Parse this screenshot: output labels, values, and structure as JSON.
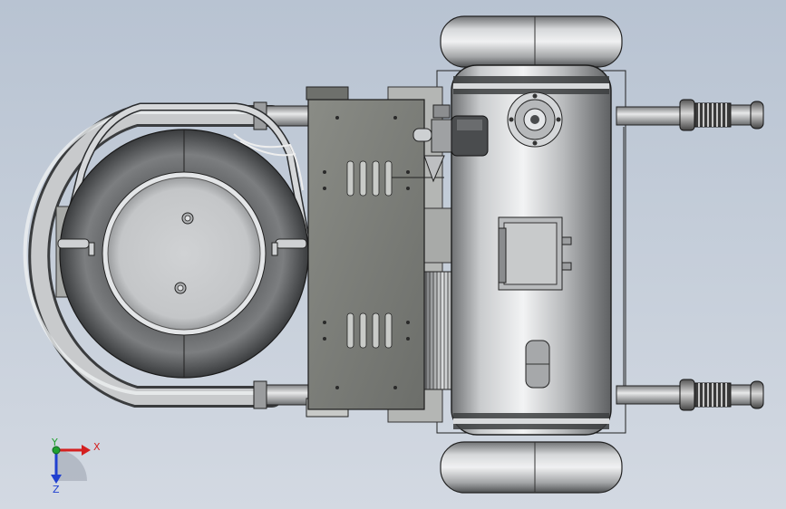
{
  "view": {
    "background_top": "#b8c3d2",
    "background_bottom": "#d3d9e2",
    "model_subject": "compressor-assembly-top-view"
  },
  "triad": {
    "x_label": "X",
    "y_label": "Y",
    "z_label": "Z",
    "x_color": "#d42020",
    "y_color": "#20a030",
    "z_color": "#2040d0"
  },
  "colors": {
    "metal_dark": "#4a4c4e",
    "metal_mid": "#9a9c9e",
    "metal_light": "#e6e8ea",
    "plate": "#7a7c78",
    "edge": "#1e1e1e"
  }
}
